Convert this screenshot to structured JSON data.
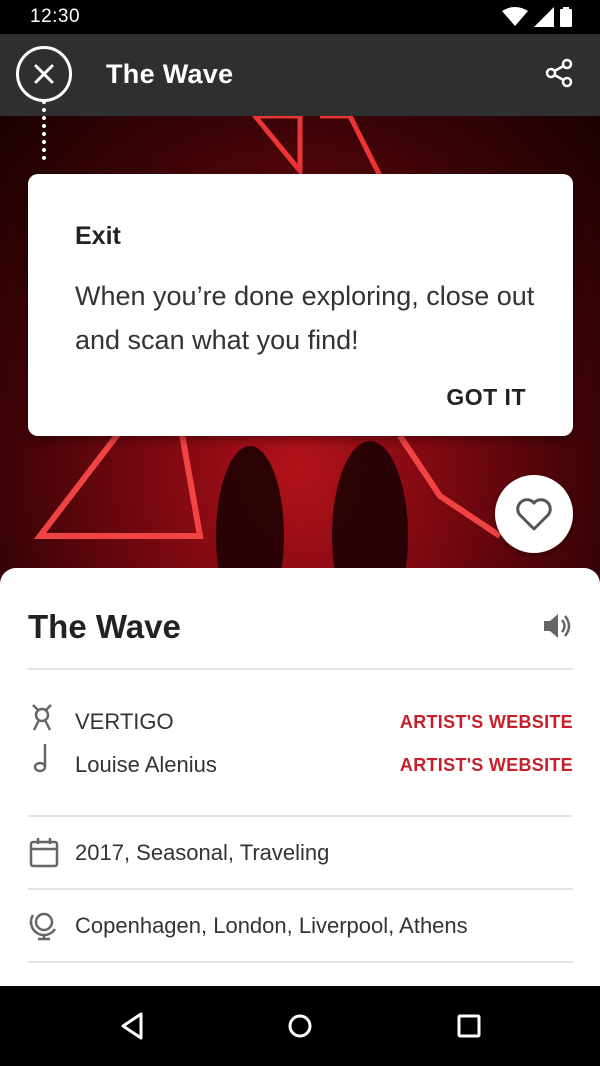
{
  "status": {
    "time": "12:30"
  },
  "app_bar": {
    "title": "The Wave"
  },
  "tooltip": {
    "title": "Exit",
    "body": "When you’re done exploring, close out and scan what you find!",
    "button": "GOT IT"
  },
  "detail": {
    "title": "The Wave",
    "artists": [
      {
        "name": "VERTIGO",
        "link": "ARTIST'S WEBSITE",
        "icon": "person-icon"
      },
      {
        "name": "Louise Alenius",
        "link": "ARTIST'S WEBSITE",
        "icon": "music-note-icon"
      }
    ],
    "date": "2017, Seasonal, Traveling",
    "locations": "Copenhagen, London, Liverpool, Athens"
  },
  "colors": {
    "accent": "#c8202a",
    "app_bar": "#2f2f2f",
    "hero_red": "#b3121a"
  }
}
